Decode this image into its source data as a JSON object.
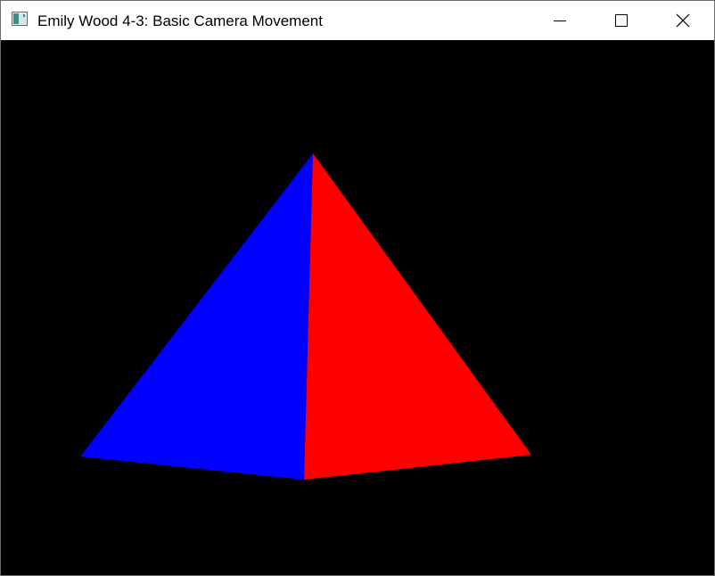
{
  "window": {
    "title": "Emily Wood 4-3: Basic Camera Movement",
    "icon": "app-window-icon",
    "controls": {
      "minimize_icon": "minimize-icon",
      "maximize_icon": "maximize-icon",
      "close_icon": "close-icon"
    }
  },
  "scene": {
    "background_color": "#000000",
    "object": "pyramid",
    "faces": [
      {
        "name": "left-face",
        "color": "#0000ff"
      },
      {
        "name": "right-face",
        "color": "#ff0000"
      }
    ]
  }
}
